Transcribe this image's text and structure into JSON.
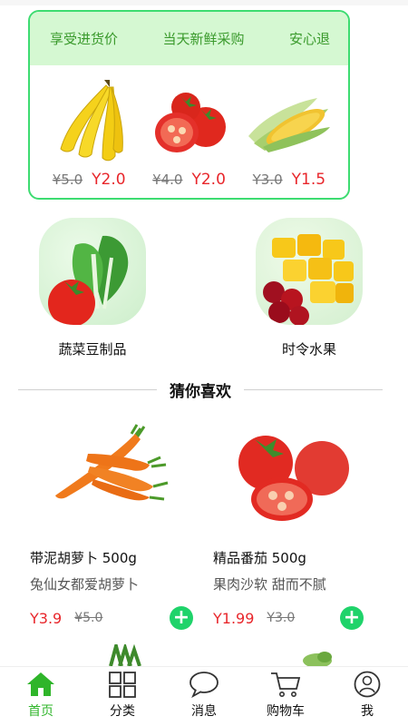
{
  "promo": {
    "tags": [
      "享受进货价",
      "当天新鲜采购",
      "安心退"
    ],
    "items": [
      {
        "name": "banana",
        "old_price": "¥5.0",
        "new_price": "Y2.0"
      },
      {
        "name": "tomato",
        "old_price": "¥4.0",
        "new_price": "Y2.0"
      },
      {
        "name": "corn",
        "old_price": "Y3.0",
        "new_price": "Y1.5"
      }
    ]
  },
  "categories": [
    {
      "label": "蔬菜豆制品"
    },
    {
      "label": "时令水果"
    }
  ],
  "section_title": "猜你喜欢",
  "products": [
    {
      "name": "带泥胡萝卜  500g",
      "desc": "兔仙女都爱胡萝卜",
      "new_price": "Y3.9",
      "old_price": "¥5.0",
      "add_label": "+"
    },
    {
      "name": "精品番茄  500g",
      "desc": "果肉沙软 甜而不腻",
      "new_price": "Y1.99",
      "old_price": "Y3.0",
      "add_label": "+"
    }
  ],
  "tabs": [
    {
      "label": "首页",
      "icon": "home-icon",
      "active": true
    },
    {
      "label": "分类",
      "icon": "grid-icon",
      "active": false
    },
    {
      "label": "消息",
      "icon": "chat-icon",
      "active": false
    },
    {
      "label": "购物车",
      "icon": "cart-icon",
      "active": false
    },
    {
      "label": "我",
      "icon": "user-icon",
      "active": false
    }
  ],
  "colors": {
    "accent": "#2fb52a",
    "price": "#e8262b",
    "promo_border": "#3ddc71",
    "promo_bg": "#d5f8d2"
  }
}
